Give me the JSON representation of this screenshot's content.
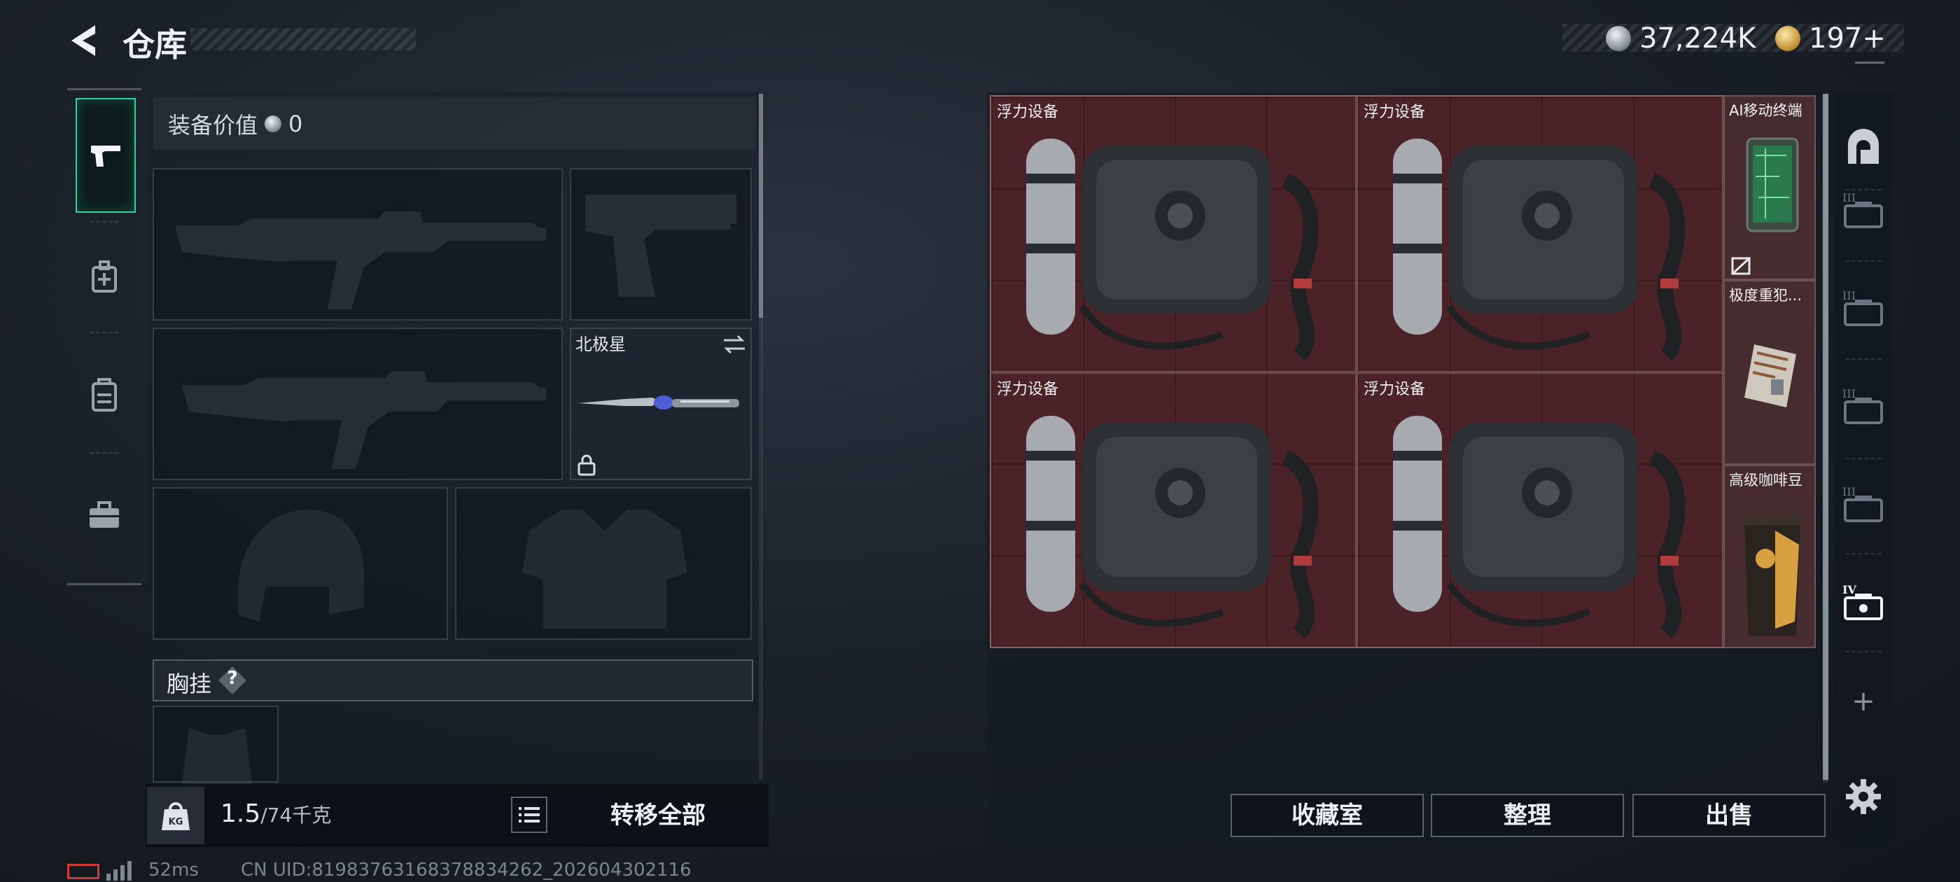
{
  "header": {
    "title": "仓库",
    "currency_silver": "37,224K",
    "currency_gold": "197+"
  },
  "left_tabs": [
    {
      "icon": "pistol-icon",
      "active": true
    },
    {
      "icon": "medkit-icon"
    },
    {
      "icon": "backpack-icon"
    },
    {
      "icon": "briefcase-icon"
    }
  ],
  "equipment": {
    "value_label": "装备价值",
    "value": "0",
    "melee_name": "北极星",
    "chest_rig_label": "胸挂",
    "help": "?"
  },
  "weight": {
    "current": "1.5",
    "capacity": "/74千克",
    "kg_icon_label": "KG"
  },
  "transfer_all": "转移全部",
  "storage_items": [
    {
      "name": "浮力设备"
    },
    {
      "name": "浮力设备"
    },
    {
      "name": "浮力设备"
    },
    {
      "name": "浮力设备"
    },
    {
      "name": "AI移动终端"
    },
    {
      "name": "极度重犯..."
    },
    {
      "name": "高级咖啡豆"
    }
  ],
  "rail": {
    "tier_labels": [
      "III",
      "III",
      "III",
      "III",
      "IV"
    ],
    "add": "+"
  },
  "actions": {
    "collection": "收藏室",
    "sort": "整理",
    "sell": "出售"
  },
  "status": {
    "ping": "52ms",
    "uid": "CN UID:8198376316837883426​2_202604302116"
  },
  "colors": {
    "accent": "#2dd29f",
    "storage_bg": "#4a2227"
  }
}
